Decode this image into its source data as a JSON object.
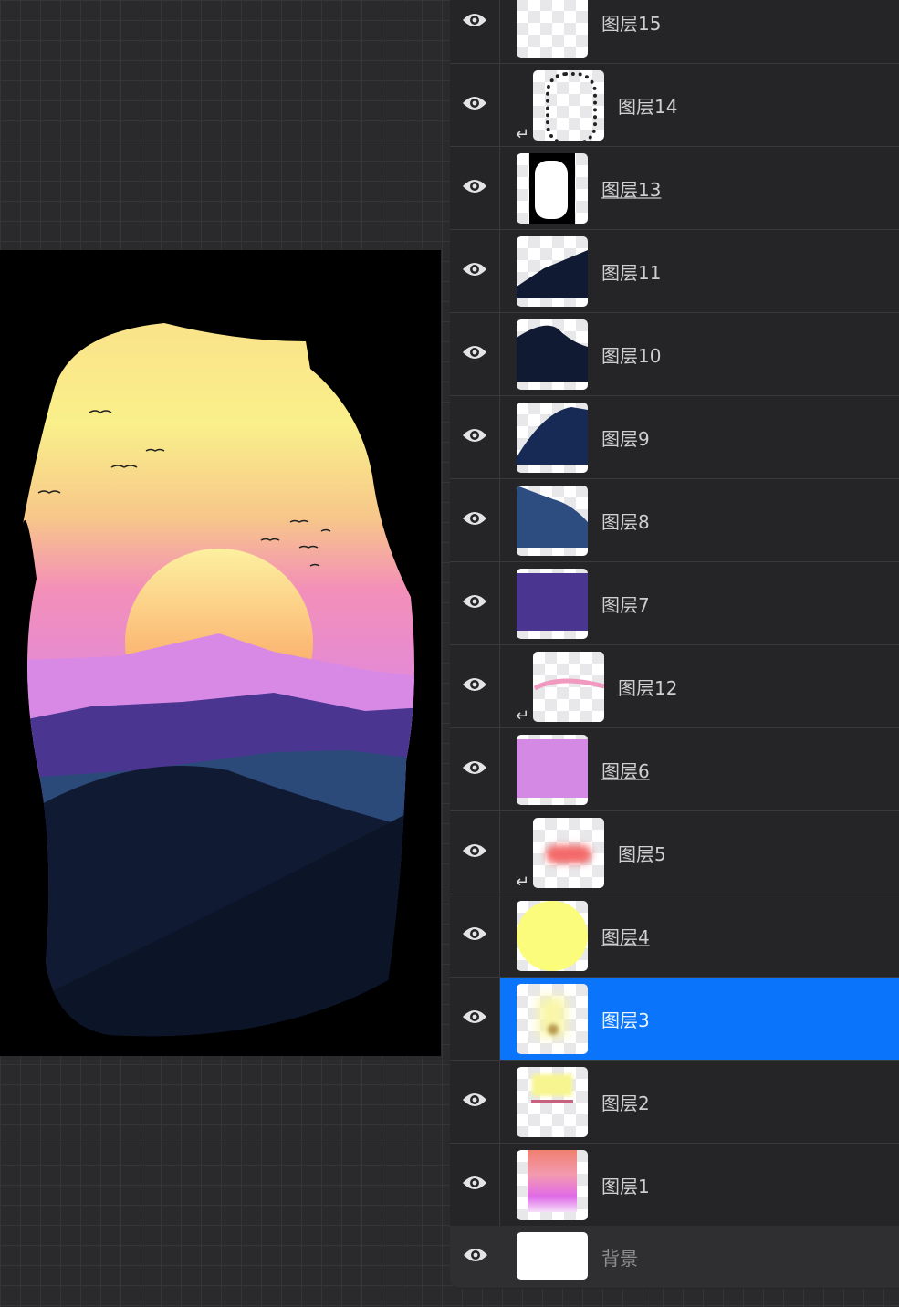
{
  "layers": [
    {
      "name": "图层15",
      "visible": true,
      "clipped": false,
      "underlined": false,
      "selected": false,
      "thumb": "birds"
    },
    {
      "name": "图层14",
      "visible": true,
      "clipped": true,
      "underlined": false,
      "selected": false,
      "thumb": "frame"
    },
    {
      "name": "图层13",
      "visible": true,
      "clipped": false,
      "underlined": true,
      "selected": false,
      "thumb": "mask"
    },
    {
      "name": "图层11",
      "visible": true,
      "clipped": false,
      "underlined": false,
      "selected": false,
      "thumb": "slope"
    },
    {
      "name": "图层10",
      "visible": true,
      "clipped": false,
      "underlined": false,
      "selected": false,
      "thumb": "hill"
    },
    {
      "name": "图层9",
      "visible": true,
      "clipped": false,
      "underlined": false,
      "selected": false,
      "thumb": "hill2"
    },
    {
      "name": "图层8",
      "visible": true,
      "clipped": false,
      "underlined": false,
      "selected": false,
      "thumb": "blue"
    },
    {
      "name": "图层7",
      "visible": true,
      "clipped": false,
      "underlined": false,
      "selected": false,
      "thumb": "purple"
    },
    {
      "name": "图层12",
      "visible": true,
      "clipped": true,
      "underlined": false,
      "selected": false,
      "thumb": "pinkline"
    },
    {
      "name": "图层6",
      "visible": true,
      "clipped": false,
      "underlined": true,
      "selected": false,
      "thumb": "lilac"
    },
    {
      "name": "图层5",
      "visible": true,
      "clipped": true,
      "underlined": false,
      "selected": false,
      "thumb": "redglow"
    },
    {
      "name": "图层4",
      "visible": true,
      "clipped": false,
      "underlined": true,
      "selected": false,
      "thumb": "sun"
    },
    {
      "name": "图层3",
      "visible": true,
      "clipped": false,
      "underlined": false,
      "selected": true,
      "thumb": "glow"
    },
    {
      "name": "图层2",
      "visible": true,
      "clipped": false,
      "underlined": false,
      "selected": false,
      "thumb": "stripes"
    },
    {
      "name": "图层1",
      "visible": true,
      "clipped": false,
      "underlined": false,
      "selected": false,
      "thumb": "gradient"
    }
  ],
  "background_layer": {
    "name": "背景",
    "visible": true
  },
  "colors": {
    "selected": "#0a74fb",
    "panel": "#252527"
  }
}
